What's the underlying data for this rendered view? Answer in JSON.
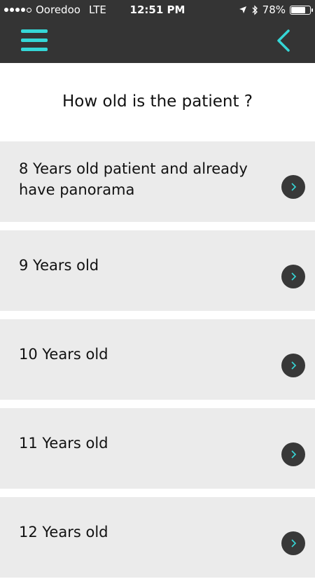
{
  "status_bar": {
    "carrier": "Ooredoo",
    "network": "LTE",
    "time": "12:51 PM",
    "battery": "78%",
    "battery_level": 0.78
  },
  "header": {
    "menu_icon": "hamburger-menu-icon",
    "back_icon": "chevron-left-icon",
    "accent_color": "#35d6d6",
    "background_color": "#343434"
  },
  "question": "How old is the patient ?",
  "options": [
    {
      "label": "8 Years old patient and already have panorama"
    },
    {
      "label": "9 Years old"
    },
    {
      "label": "10 Years old"
    },
    {
      "label": "11 Years old"
    },
    {
      "label": "12 Years old"
    }
  ]
}
